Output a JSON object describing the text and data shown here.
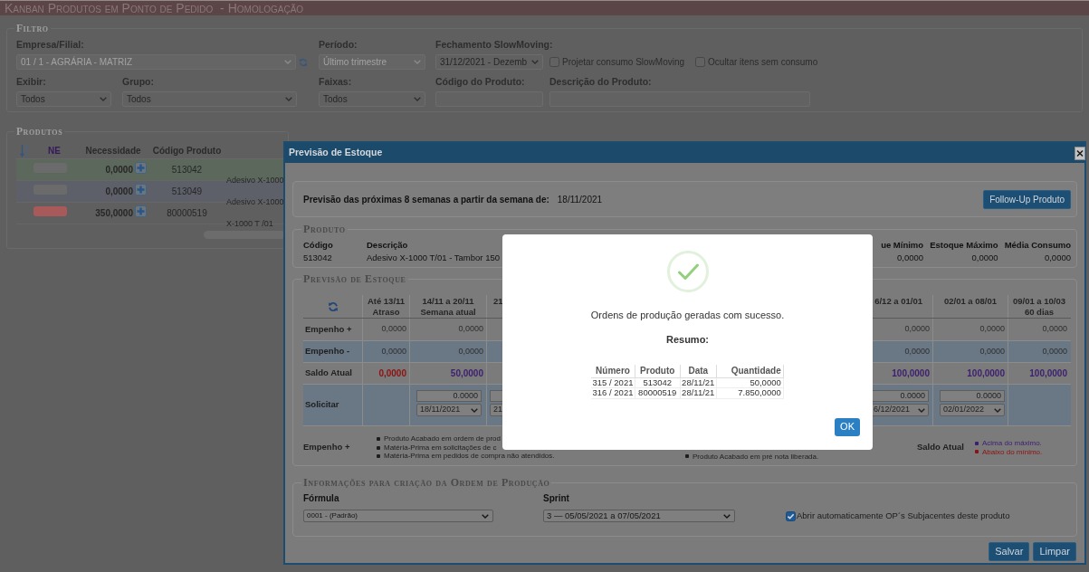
{
  "window": {
    "title": "Kanban Produtos em Ponto de Pedido  - Homologação"
  },
  "filter": {
    "legend": "Filtro",
    "rows": [
      {
        "fields": [
          {
            "kind": "select",
            "label": "Empresa/Filial:",
            "value": "01 / 1 - AGRÁRIA - MATRIZ",
            "disabled": true,
            "refresh": true
          },
          {
            "kind": "select",
            "label": "Período:",
            "value": "Último trimestre",
            "disabled": true,
            "refresh": false
          },
          {
            "kind": "select",
            "label": "Fechamento SlowMoving:",
            "value": "31/12/2021 - Dezemb",
            "disabled": false,
            "refresh": false
          },
          {
            "kind": "checkbox",
            "label": "Projetar consumo SlowMoving",
            "checked": false
          },
          {
            "kind": "checkbox",
            "label": "Ocultar itens sem consumo",
            "checked": false
          }
        ]
      },
      {
        "fields": [
          {
            "kind": "select",
            "label": "Exibir:",
            "value": "Todos",
            "disabled": false,
            "refresh": false
          },
          {
            "kind": "select",
            "label": "Grupo:",
            "value": "Todos",
            "disabled": false,
            "refresh": false
          },
          {
            "kind": "select",
            "label": "Faixas:",
            "value": "Todos",
            "disabled": false,
            "refresh": false
          },
          {
            "kind": "input",
            "label": "Código do Produto:"
          },
          {
            "kind": "input",
            "label": "Descrição do Produto:"
          }
        ]
      }
    ]
  },
  "products": {
    "legend": "Produtos",
    "columns": [
      "NE",
      "Necessidade",
      "Código Produto"
    ],
    "rows": [
      {
        "color": "#5c685b",
        "ne": {
          "color": "#6b6b6b"
        },
        "necessidade": "0,0000",
        "codigo": "513042",
        "column_4": "Adesivo X-1000"
      },
      {
        "color": "#5d6069",
        "ne": {
          "color": "#6b6b6b"
        },
        "necessidade": "0,0000",
        "codigo": "513049",
        "column_4": "Adesivo X-1000"
      },
      {
        "color": "#5f5f5f",
        "ne": {
          "color": "#a85959"
        },
        "necessidade": "350,0000",
        "codigo": "80000519",
        "column_4": "X-1000 T /01"
      }
    ]
  },
  "stock_forecast_modal": {
    "title": "Previsão de Estoque",
    "intro": {
      "label": "Previsão das próximas 8 semanas a partir da semana de:",
      "date": "18/11/2021"
    },
    "follow_up_button": "Follow-Up Produto",
    "product": {
      "legend": "Produto",
      "fields": [
        {
          "label": "Código",
          "value": "513042"
        },
        {
          "label": "Descrição",
          "value": "Adesivo X-1000 T/01 - Tambor 150"
        },
        {
          "label": "ue Mínimo",
          "value": "0,0000"
        },
        {
          "label": "Estoque Máximo",
          "value": "0,0000"
        },
        {
          "label": "Média Consumo",
          "value": "0,0000"
        }
      ]
    },
    "forecast": {
      "legend": "Previsão de Estoque",
      "columns": [
        {
          "title": "Até 13/11",
          "subtitle": "Atraso"
        },
        {
          "title": "14/11 a 20/11",
          "subtitle": "Semana atual"
        },
        {
          "title": "21"
        },
        {
          "title": "6/12 a 01/01"
        },
        {
          "title": "02/01 a 08/01"
        },
        {
          "title": "09/01 a 10/03",
          "subtitle": "60 dias"
        }
      ],
      "rows": [
        {
          "kind": "values",
          "label": "Empenho +",
          "cells": [
            {
              "text": "0,0000"
            },
            {
              "text": "0,0000"
            },
            null,
            {
              "text": "0,0000"
            },
            {
              "text": "0,0000"
            },
            {
              "text": "0,0000"
            }
          ]
        },
        {
          "kind": "values",
          "label": "Empenho -",
          "cells": [
            {
              "text": "0,0000"
            },
            {
              "text": "0,0000"
            },
            null,
            {
              "text": "0,0000"
            },
            {
              "text": "0,0000"
            },
            {
              "text": "0,0000"
            }
          ]
        },
        {
          "kind": "balance",
          "label": "Saldo Atual",
          "cells": [
            {
              "text": "0,0000",
              "color": "#8e1111"
            },
            {
              "text": "50,0000",
              "color": "#3c1f6e"
            },
            null,
            {
              "text": "100,0000",
              "color": "#3c1f6e"
            },
            {
              "text": "100,0000",
              "color": "#3c1f6e"
            },
            {
              "text": "100,0000",
              "color": "#3c1f6e"
            }
          ]
        },
        {
          "kind": "inputs",
          "label": "Solicitar",
          "cells": [
            null,
            {
              "quantity": "0.0000",
              "date": "18/11/2021"
            },
            {
              "date": "21"
            },
            {
              "quantity": "0.0000",
              "date": "6/12/2021"
            },
            {
              "quantity": "0.0000",
              "date": "02/01/2022"
            },
            null
          ]
        }
      ],
      "notes": [
        {
          "title": "Empenho +",
          "items": [
            {
              "text": "Produto Acabado em ordem de prod"
            },
            {
              "text": "Matéria-Prima em solicitações de c"
            },
            {
              "text": "Matéria-Prima em pedidos de compra não atendidos."
            }
          ]
        },
        {
          "items": [
            {
              "text": "Produto Acabado em pré nota liberada."
            }
          ]
        },
        {
          "title": "Saldo Atual",
          "items": [
            {
              "text": "Acima do máximo.",
              "color": "#3c1f6e"
            },
            {
              "text": "Abaixo do mínimo.",
              "color": "#8e1111"
            }
          ]
        }
      ]
    },
    "production_order": {
      "legend": "Informações para criação da Ordem de Produção",
      "fields": [
        {
          "kind": "select",
          "label": "Fórmula",
          "value": "0001 - (Padrão)"
        },
        {
          "kind": "select",
          "label": "Sprint",
          "value": "3 — 05/05/2021 a 07/05/2021"
        },
        {
          "kind": "checkbox",
          "label": "Abrir automaticamente OP´s Subjacentes deste produto",
          "checked": true
        }
      ]
    },
    "buttons": [
      {
        "label": "Salvar"
      },
      {
        "label": "Limpar"
      }
    ]
  },
  "success_dialog": {
    "message": "Ordens de produção geradas com sucesso.",
    "summary_label": "Resumo:",
    "summary": {
      "columns": [
        "Número",
        "Produto",
        "Data",
        "Quantidade"
      ],
      "rows": [
        [
          "315 / 2021",
          "513042",
          "28/11/21",
          "50,0000"
        ],
        [
          "316 / 2021",
          "80000519",
          "28/11/21",
          "7.850,0000"
        ]
      ]
    },
    "ok_button": "OK"
  }
}
